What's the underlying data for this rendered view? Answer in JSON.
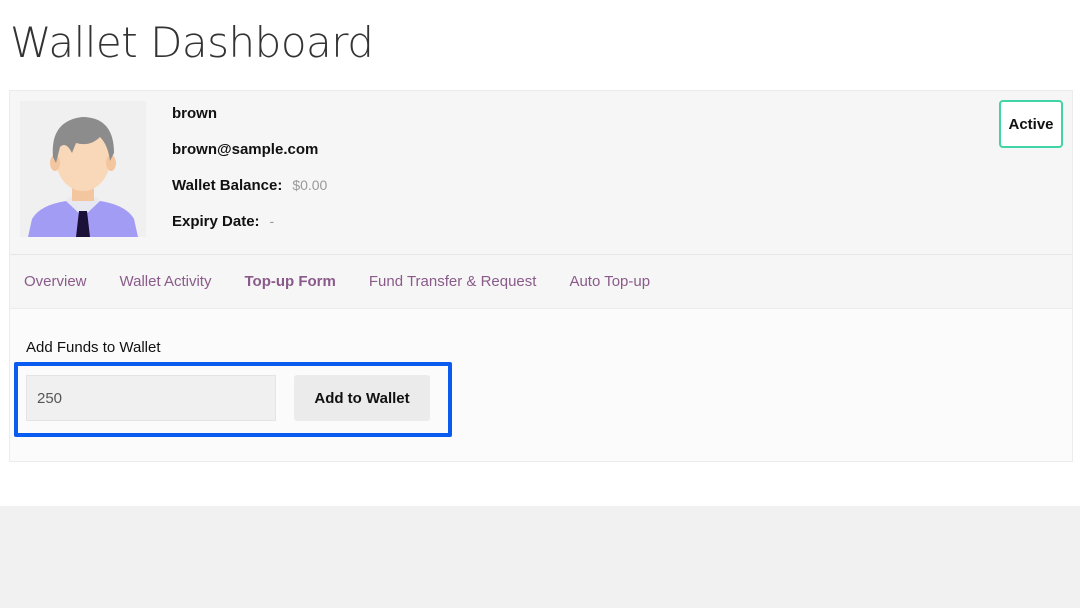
{
  "page": {
    "title": "Wallet Dashboard"
  },
  "user": {
    "name": "brown",
    "email": "brown@sample.com",
    "balance_label": "Wallet Balance:",
    "balance_value": "$0.00",
    "expiry_label": "Expiry Date:",
    "expiry_value": "-",
    "status": "Active"
  },
  "tabs": [
    {
      "label": "Overview"
    },
    {
      "label": "Wallet Activity"
    },
    {
      "label": "Top-up Form",
      "active": true
    },
    {
      "label": "Fund Transfer & Request"
    },
    {
      "label": "Auto Top-up"
    }
  ],
  "topup": {
    "label": "Add Funds to Wallet",
    "amount_value": "250",
    "button_label": "Add to Wallet"
  },
  "colors": {
    "accent_tab": "#8a5a8a",
    "status_border": "#3fd5a6",
    "highlight": "#0a5cf0"
  }
}
